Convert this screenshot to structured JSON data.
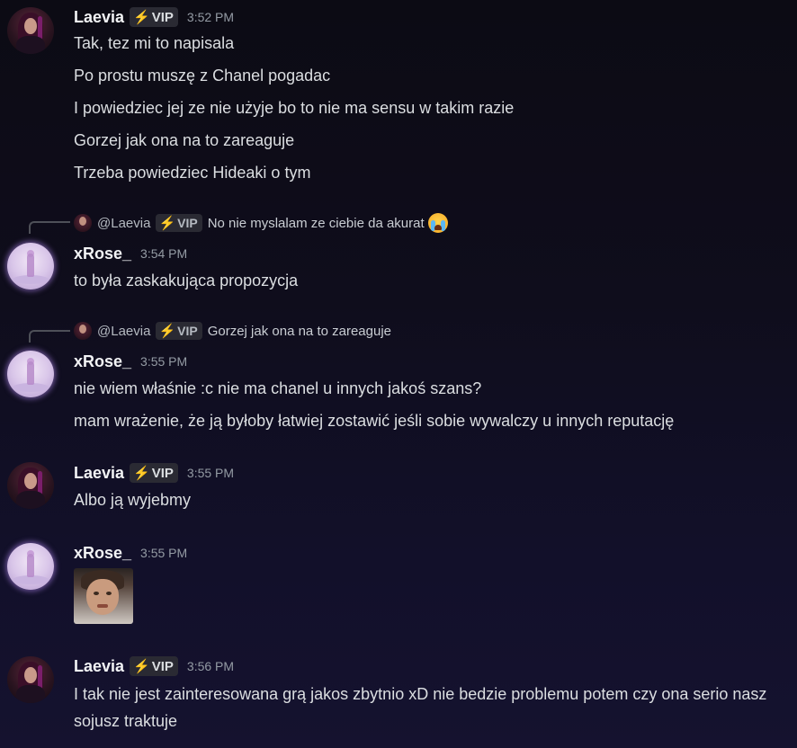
{
  "messages": [
    {
      "author": "Laevia",
      "badge": "VIP",
      "badge_icon": "lightning-icon",
      "time": "3:52 PM",
      "lines": [
        "Tak, tez mi to napisala",
        "Po prostu muszę z Chanel pogadac",
        "I powiedziec jej ze nie użyje bo to nie ma sensu w takim razie",
        "Gorzej jak ona na to zareaguje",
        "Trzeba powiedziec Hideaki o tym"
      ]
    },
    {
      "reply": {
        "mention": "@Laevia",
        "badge": "VIP",
        "quote": "No nie myslalam ze ciebie da akurat",
        "emoji": "loudly-crying-face"
      },
      "author": "xRose_",
      "time": "3:54 PM",
      "lines": [
        "to była zaskakująca propozycja"
      ]
    },
    {
      "reply": {
        "mention": "@Laevia",
        "badge": "VIP",
        "quote": "Gorzej jak ona na to zareaguje"
      },
      "author": "xRose_",
      "time": "3:55 PM",
      "lines": [
        "nie wiem właśnie :c nie ma chanel u innych jakoś szans?",
        "mam wrażenie, że ją byłoby łatwiej zostawić jeśli sobie wywalczy u innych reputację"
      ]
    },
    {
      "author": "Laevia",
      "badge": "VIP",
      "badge_icon": "lightning-icon",
      "time": "3:55 PM",
      "lines": [
        "Albo ją wyjebmy"
      ]
    },
    {
      "author": "xRose_",
      "time": "3:55 PM",
      "attachment": "reaction-gif"
    },
    {
      "author": "Laevia",
      "badge": "VIP",
      "badge_icon": "lightning-icon",
      "time": "3:56 PM",
      "lines": [
        "I tak nie jest zainteresowana grą jakos zbytnio xD nie bedzie problemu potem czy ona serio nasz sojusz traktuje"
      ]
    }
  ],
  "colors": {
    "background": "#0f0d1c",
    "username": "#f2f3f5",
    "text": "#dbdee1",
    "timestamp": "#949ba4",
    "badge_bg": "#2a2a33",
    "bolt": "#f5c518"
  }
}
